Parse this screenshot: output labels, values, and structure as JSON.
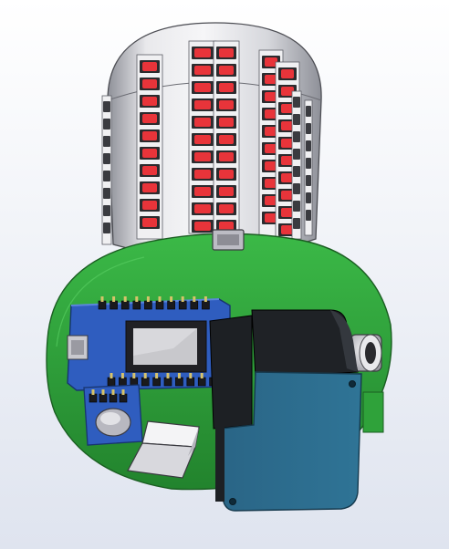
{
  "scene": {
    "background": {
      "top": "#ffffff",
      "bottom": "#dfe4ef"
    },
    "colors": {
      "cylinder_light": "#f4f4f6",
      "cylinder_mid": "#c9cbd2",
      "cylinder_dark": "#8e9098",
      "led_red": "#e8343a",
      "led_housing": "#2b2b2e",
      "strip_light": "#f0f0f2",
      "pcb_green": "#2ea63a",
      "pcb_green_dark": "#1f7a29",
      "board_blue": "#2f5dbf",
      "board_blue_dark": "#1c3f8c",
      "oled_frame": "#202024",
      "oled_screen": "#c8c8cc",
      "sensor_teal": "#2e6e8f",
      "sensor_dark": "#1d2024",
      "plug_grey": "#e4e4e8",
      "silver": "#c6c6cc"
    }
  }
}
